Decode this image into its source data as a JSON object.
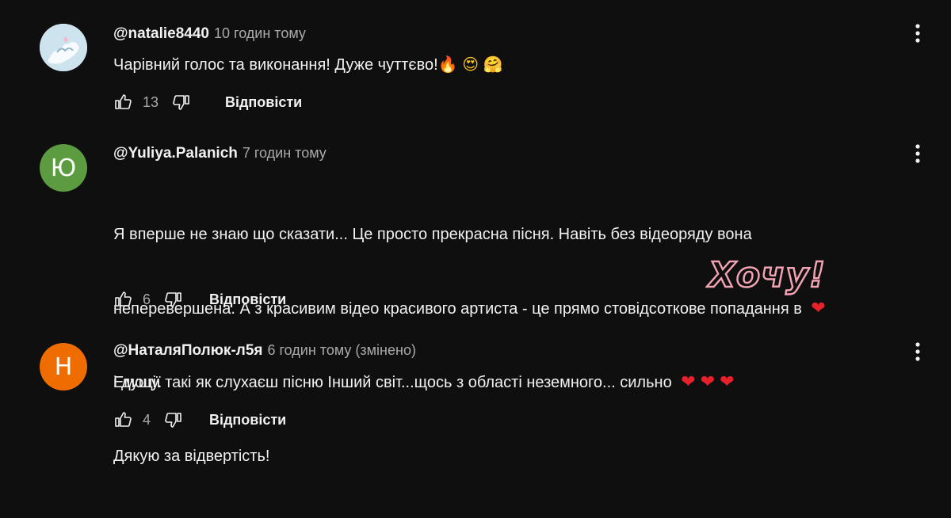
{
  "comments": [
    {
      "author": "@natalie8440",
      "time": "10 годин тому",
      "text": "Чарівний голос та виконання! Дуже чуттєво!",
      "emojis": [
        "🔥",
        "😍",
        "🤗"
      ],
      "likes": "13",
      "reply_label": "Відповісти"
    },
    {
      "author": "@Yuliya.Palanich",
      "time": "7 годин тому",
      "avatar_letter": "Ю",
      "avatar_color": "#5c9b3f",
      "text_line1": "Я вперше не знаю що сказати... Це просто прекрасна пісня. Навіть без відеоряду вона",
      "text_line2": "неперевершена. А з красивим відео красивого артиста - це прямо стовідсоткове попадання в",
      "heart": "❤",
      "text_line3": "і душу.",
      "text_line4": "Дякую за відвертість!",
      "likes": "6",
      "reply_label": "Відповісти"
    },
    {
      "author": "@НаталяПолюк-л5я",
      "time": "6 годин тому (змінено)",
      "avatar_letter": "Н",
      "avatar_color": "#ef6c00",
      "text": "Емоції такі як слухаєш пісню Інший світ...щось з області неземного... сильно",
      "hearts": [
        "❤",
        "❤",
        "❤"
      ],
      "likes": "4",
      "reply_label": "Відповісти"
    }
  ],
  "sticker": {
    "text": "Хочу!",
    "color": "#f4a4b4"
  },
  "colors": {
    "background": "#0f0f0f",
    "text_primary": "#f1f1f1",
    "text_secondary": "#aaaaaa"
  },
  "icons": {
    "like": "thumbs-up-icon",
    "dislike": "thumbs-down-icon",
    "more": "more-vertical-icon"
  }
}
